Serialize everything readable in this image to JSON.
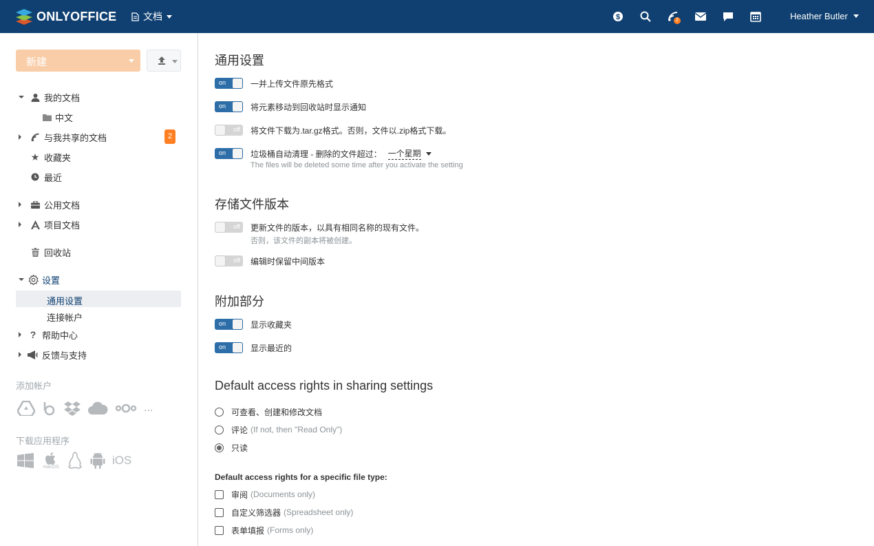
{
  "header": {
    "logo_text": "ONLYOFFICE",
    "module_label": "文档",
    "feed_badge": "2",
    "user_name": "Heather Butler"
  },
  "sidebar": {
    "new_button": "新建",
    "nav": {
      "my_documents": "我的文档",
      "my_documents_sub": "中文",
      "shared": "与我共享的文档",
      "shared_badge": "2",
      "favorites": "收藏夹",
      "recent": "最近",
      "common": "公用文档",
      "projects": "项目文档",
      "trash": "回收站",
      "settings": "设置",
      "settings_general": "通用设置",
      "settings_accounts": "连接帐户",
      "help": "帮助中心",
      "feedback": "反馈与支持"
    },
    "add_account_label": "添加帐户",
    "download_apps_label": "下载应用程序",
    "ios_label": "iOS",
    "macos_label": "macOS",
    "more_label": "..."
  },
  "main": {
    "general_title": "通用设置",
    "general": [
      {
        "state": "on",
        "label": "一并上传文件原先格式"
      },
      {
        "state": "on",
        "label": "将元素移动到回收站时显示通知"
      },
      {
        "state": "off",
        "label": "将文件下载为.tar.gz格式。否则，文件以.zip格式下载。"
      },
      {
        "state": "on",
        "label": "垃圾桶自动清理 - 删除的文件超过：",
        "dropdown": "一个星期",
        "hint": "The files will be deleted some time after you activate the setting"
      }
    ],
    "versions_title": "存储文件版本",
    "versions": [
      {
        "state": "off",
        "label": "更新文件的版本，以具有相同名称的现有文件。",
        "hint": "否则，该文件的副本将被创建。"
      },
      {
        "state": "off",
        "label": "编辑时保留中间版本"
      }
    ],
    "additional_title": "附加部分",
    "additional": [
      {
        "state": "on",
        "label": "显示收藏夹"
      },
      {
        "state": "on",
        "label": "显示最近的"
      }
    ],
    "access_title": "Default access rights in sharing settings",
    "access_options": [
      {
        "label": "可查看、创建和修改文档",
        "note": "",
        "checked": false
      },
      {
        "label": "评论",
        "note": "(If not, then \"Read Only\")",
        "checked": false
      },
      {
        "label": "只读",
        "note": "",
        "checked": true
      }
    ],
    "filetype_title": "Default access rights for a specific file type:",
    "filetype_options": [
      {
        "label": "审阅",
        "note": "(Documents only)"
      },
      {
        "label": "自定义筛选器",
        "note": "(Spreadsheet only)"
      },
      {
        "label": "表单填报",
        "note": "(Forms only)"
      }
    ],
    "toggle_on_text": "on",
    "toggle_off_text": "off"
  }
}
